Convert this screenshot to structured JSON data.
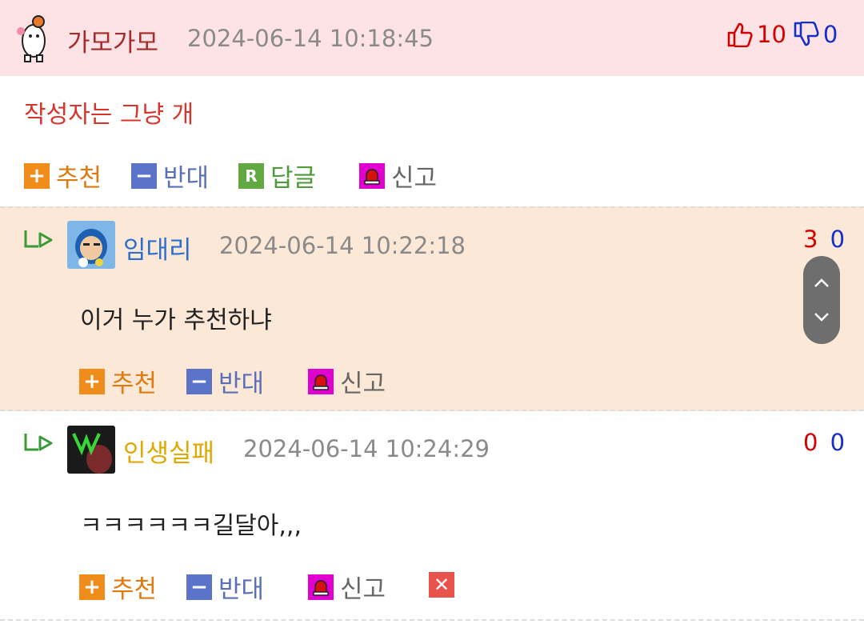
{
  "comments": [
    {
      "nick": "가모가모",
      "nick_color": "#a52a2a",
      "time": "2024-06-14 10:18:45",
      "up": "10",
      "down": "0",
      "text": "작성자는 그냥 개",
      "text_color": "#d9342b",
      "actions": {
        "recommend": "추천",
        "oppose": "반대",
        "reply": "답글",
        "report": "신고"
      }
    },
    {
      "nick": "임대리",
      "nick_color": "#2b6fd0",
      "time": "2024-06-14 10:22:18",
      "up": "3",
      "down": "0",
      "text": "이거 누가 추천하냐",
      "actions": {
        "recommend": "추천",
        "oppose": "반대",
        "report": "신고"
      }
    },
    {
      "nick": "인생실패",
      "nick_color": "#e0a800",
      "time": "2024-06-14 10:24:29",
      "up": "0",
      "down": "0",
      "text": "ㅋㅋㅋㅋㅋㅋ길달아,,,",
      "actions": {
        "recommend": "추천",
        "oppose": "반대",
        "report": "신고"
      }
    }
  ],
  "colors": {
    "up": "#d40000",
    "down": "#1530c8",
    "reply_arrow": "#3a9a3a"
  },
  "icons": {
    "recommend": "plus-icon",
    "oppose": "minus-icon",
    "reply": "reply-r-icon",
    "report": "siren-icon",
    "delete": "close-icon",
    "thumbs_up": "thumbs-up-icon",
    "thumbs_down": "thumbs-down-icon",
    "scroll_up": "chevron-up-icon",
    "scroll_down": "chevron-down-icon"
  }
}
